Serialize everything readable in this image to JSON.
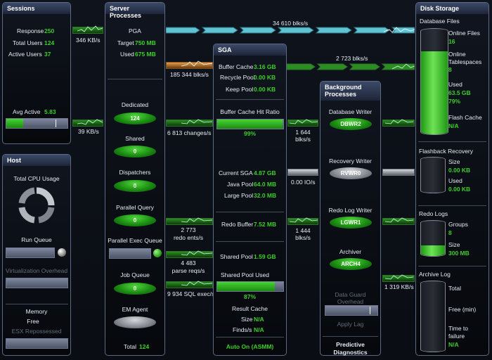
{
  "sessions": {
    "title": "Sessions",
    "response_label": "Response",
    "response": "250",
    "total_users_label": "Total Users",
    "total_users": "124",
    "active_users_label": "Active Users",
    "active_users": "37",
    "avg_active_label": "Avg Active",
    "avg_active": "5.83"
  },
  "host": {
    "title": "Host",
    "cpu_label": "Total CPU Usage",
    "run_queue_label": "Run Queue",
    "virt_label": "Virtualization Overhead",
    "memory_label": "Memory",
    "free_label": "Free",
    "esx_label": "ESX Repossessed"
  },
  "flows": {
    "sessions_top": "346 KB/s",
    "sessions_bottom": "39 KB/s",
    "top_right": "34 610 blks/s",
    "second_right": "2 723 blks/s",
    "pga_out": "185 344 blks/s",
    "changes": "6 813 changes/s",
    "sga_bg1": "1 644",
    "sga_bg1_unit": "blks/s",
    "io": "0.00 IO/s",
    "redo_ents": "2 773",
    "redo_ents_unit": "redo ents/s",
    "sga_bg2": "1 444",
    "sga_bg2_unit": "blks/s",
    "parse": "4 483",
    "parse_unit": "parse reqs/s",
    "sql_exec": "9 934 SQL exec/s",
    "archive": "1 319 KB/s"
  },
  "server": {
    "title": "Server Processes",
    "pga_label": "PGA",
    "target_label": "Target",
    "target": "750 MB",
    "used_label": "Used",
    "used": "675 MB",
    "dedicated_label": "Dedicated",
    "dedicated": "124",
    "shared_label": "Shared",
    "shared": "0",
    "dispatchers_label": "Dispatchers",
    "dispatchers": "0",
    "pq_label": "Parallel Query",
    "pq": "0",
    "peq_label": "Parallel Exec Queue",
    "jq_label": "Job Queue",
    "jq": "0",
    "em_label": "EM Agent",
    "total_label": "Total",
    "total": "124"
  },
  "sga": {
    "title": "SGA",
    "buffer_cache_label": "Buffer Cache",
    "buffer_cache": "3.16 GB",
    "recycle_label": "Recycle Pool",
    "recycle": "0.00 KB",
    "keep_label": "Keep Pool",
    "keep": "0.00 KB",
    "hit_ratio_label": "Buffer Cache Hit Ratio",
    "hit_ratio": "99%",
    "hit_ratio_fraction": 0.99,
    "current_label": "Current SGA",
    "current": "4.87 GB",
    "java_label": "Java Pool",
    "java": "64.0 MB",
    "large_label": "Large Pool",
    "large": "32.0 MB",
    "redo_label": "Redo Buffer",
    "redo": "7.52 MB",
    "shared_pool_label": "Shared Pool",
    "shared_pool": "1.59 GB",
    "shared_used_label": "Shared Pool Used",
    "shared_used": "87%",
    "shared_used_fraction": 0.87,
    "result_cache_label": "Result Cache",
    "size_label": "Size",
    "size": "N/A",
    "finds_label": "Finds/s",
    "finds": "N/A",
    "auto": "Auto On (ASMM)"
  },
  "bg": {
    "title1": "Background",
    "title2": "Processes",
    "dbw_label": "Database Writer",
    "dbw": "DBWR2",
    "rw_label": "Recovery Writer",
    "rw": "RVWR0",
    "rlw_label": "Redo Log Writer",
    "rlw": "LGWR1",
    "arch_label": "Archiver",
    "arch": "ARCH4",
    "dg1": "Data Guard",
    "dg2": "Overhead",
    "apply_label": "Apply Lag",
    "pred1": "Predictive",
    "pred2": "Diagnostics"
  },
  "disk": {
    "title": "Disk Storage",
    "db_files_label": "Database Files",
    "online_files_label": "Online Files",
    "online_files": "16",
    "online_ts_label1": "Online",
    "online_ts_label2": "Tablespaces",
    "online_ts": "8",
    "used_label": "Used",
    "used": "63.5 GB",
    "used_pct": "79%",
    "used_fraction": 0.79,
    "flash_label": "Flash Cache",
    "flash": "N/A",
    "fr_label": "Flashback Recovery",
    "fr_size_label": "Size",
    "fr_size": "0.00 KB",
    "fr_used_label": "Used",
    "fr_used": "0.00 KB",
    "redo_logs_label": "Redo Logs",
    "groups_label": "Groups",
    "groups": "8",
    "rl_size_label": "Size",
    "rl_size": "300 MB",
    "archive_label": "Archive Log",
    "total_label": "Total",
    "free_label": "Free (min)",
    "ttf_label1": "Time to",
    "ttf_label2": "failure",
    "ttf": "N/A"
  }
}
